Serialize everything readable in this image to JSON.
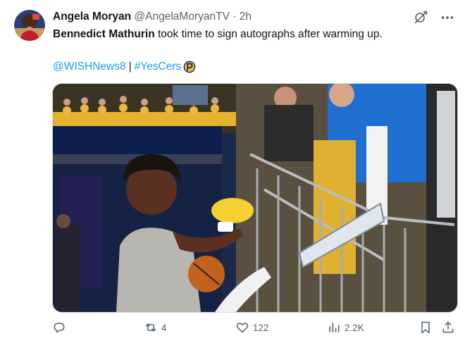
{
  "tweet": {
    "author_name": "Angela Moryan",
    "author_handle": "@AngelaMoryanTV",
    "separator": "·",
    "time": "2h",
    "mention_name": "Bennedict Mathurin",
    "text_rest": " took time to sign autographs after warming up.",
    "link_1": "@WISHNews8",
    "link_sep": "|",
    "link_2": "#YesCers",
    "media_description_icon": "pacers-logo-icon"
  },
  "actions": {
    "reply_count": "",
    "retweet_count": "4",
    "like_count": "122",
    "views_count": "2.2K"
  },
  "icons": [
    "grok-icon",
    "more-icon",
    "reply-icon",
    "retweet-icon",
    "like-icon",
    "views-icon",
    "bookmark-icon",
    "share-icon"
  ],
  "colors": {
    "link": "#1d9bf0",
    "secondary": "#536471",
    "pacers_gold": "#fdbb30",
    "pacers_navy": "#002d62"
  }
}
